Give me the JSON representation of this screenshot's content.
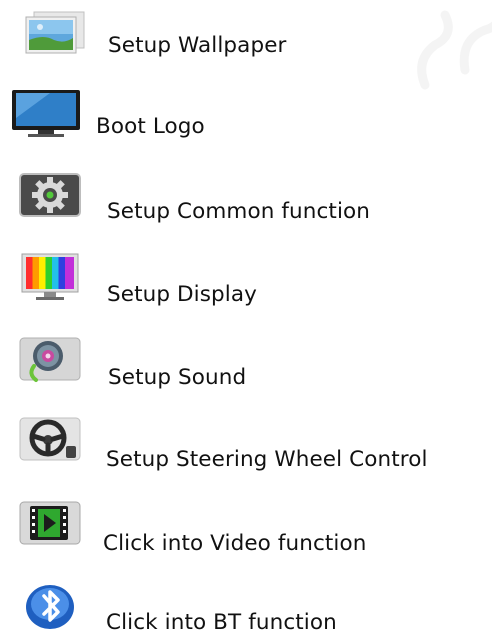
{
  "menu": {
    "items": [
      {
        "label": "Setup Wallpaper",
        "icon": "wallpaper-icon"
      },
      {
        "label": "Boot Logo",
        "icon": "monitor-icon"
      },
      {
        "label": "Setup Common function",
        "icon": "gear-icon"
      },
      {
        "label": "Setup Display",
        "icon": "color-bars-monitor-icon"
      },
      {
        "label": "Setup Sound",
        "icon": "speaker-icon"
      },
      {
        "label": "Setup Steering Wheel Control",
        "icon": "steering-wheel-icon"
      },
      {
        "label": "Click into Video function",
        "icon": "video-play-icon"
      },
      {
        "label": "Click into BT function",
        "icon": "bluetooth-icon"
      }
    ]
  },
  "watermark": {
    "color": "#9e9e9e"
  }
}
